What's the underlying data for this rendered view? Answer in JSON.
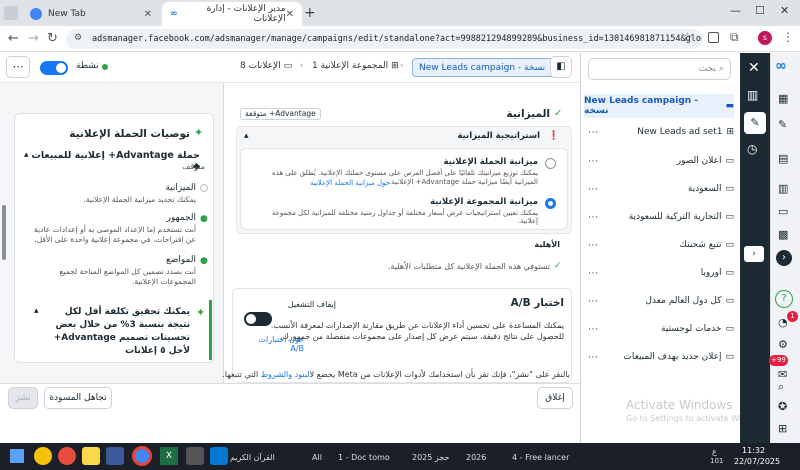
{
  "browser": {
    "tabs": [
      {
        "title": "New Tab"
      },
      {
        "title": "مدير الإعلانات - إدارة الإعلانات"
      }
    ],
    "url": "adsmanager.facebook.com/adsmanager/manage/campaigns/edit/standalone?act=998821294899289&business_id=130146981871154&global_scope_id=1301...",
    "profile_initial": "s"
  },
  "topbar": {
    "status_label": "نشطة",
    "campaign_name": "New Leads campaign - نسخة",
    "adsets_label": "1 المجموعة الإعلانية",
    "ads_label": "8 الإعلانات"
  },
  "nav": {
    "search_placeholder": "بحث",
    "items": [
      {
        "label": "New Leads campaign - نسخة"
      },
      {
        "label": "New Leads ad set1"
      },
      {
        "label": "اعلان الصور"
      },
      {
        "label": "السعودية"
      },
      {
        "label": "التجارية التركية للسعودية"
      },
      {
        "label": "تتبع شحنتك"
      },
      {
        "label": "اوروبا"
      },
      {
        "label": "كل دول العالم معدل"
      },
      {
        "label": "خدمات لوجستية"
      },
      {
        "label": "إعلان جديد بهدف المبيعات"
      }
    ]
  },
  "recommendations": {
    "title": "توصيات الحملة الإعلانية",
    "subtitle": "حملة Advantage+ إعلانية للمبيعات",
    "status": "متوقف",
    "items": [
      {
        "title": "الميزانية",
        "desc": "يمكنك تحديد ميزانية الحملة الإعلانية."
      },
      {
        "title": "الجمهور",
        "desc": "أنت تستخدم إما الإعداد الموصى به أو إعدادات عادية عن اقتراحات، في مجموعة إعلانية واحدة على الأقل."
      },
      {
        "title": "المواضع",
        "desc": "أنت بصدد تضمين كل المواضع المتاحة لجميع المجموعات الإعلانية."
      }
    ],
    "callout": "يمكنك تحقيق تكلفة أقل لكل نتيجة بنسبة 3% من خلال بعض تحسينات تصميم Advantage+ لأجل ٥ إعلانات"
  },
  "main": {
    "advantage_badge": "Advantage+ متوقفة",
    "budget_title": "الميزانية",
    "strategy_title": "استراتيجية الميزانية",
    "options": [
      {
        "title": "ميزانية الحملة الإعلانية",
        "desc": "يمكنك توزيع ميزانيتك تلقائيًا على أفضل الفرص على مستوى حملتك الإعلانية. يُطلق على هذه الميزانية أيضًا ميزانية حملة Advantage+ الإعلانية.",
        "link": "حول ميزانية الحملة الإعلانية",
        "selected": false
      },
      {
        "title": "ميزانية المجموعة الإعلانية",
        "desc": "يمكنك تعيين استراتيجيات عرض أسعار مختلفة أو جداول زمنية مختلفة للميزانية لكل مجموعة إعلانية.",
        "selected": true
      }
    ],
    "eligibility_title": "الأهلية",
    "eligibility_text": "تستوفي هذه الحملة الإعلانية كل متطلبات الأهلية.",
    "ab_title": "اختبار A/B",
    "ab_toggle_label": "إيقاف التشغيل",
    "ab_desc": "يمكنك المساعدة على تحسين أداء الإعلانات عن طريق مقارنة الإصدارات لمعرفة الأنسب. للحصول على نتائج دقيقة، سيتم عرض كل إصدار على مجموعات منفصلة من جمهورك.",
    "ab_link": "حول اختبارات A/B"
  },
  "footer": {
    "terms_prefix": "بالنقر على \"نشر\"، فإنك تقر بأن استخدامك لأدوات الإعلانات من Meta يخضع ل",
    "terms_link": "البنود والشروط",
    "terms_suffix": " التي تتبعها.",
    "close_label": "إغلاق",
    "discard_label": "تجاهل المسودة",
    "publish_label": "نشر"
  },
  "watermark": {
    "line1": "Activate Windows",
    "line2": "Go to Settings to activate Windows."
  },
  "taskbar": {
    "items": [
      "All",
      "القرآن الكريم",
      "1 - Doc tomo",
      "حجز 2025",
      "2026",
      "4 - Free lancer"
    ],
    "time": "11:32",
    "date": "22/07/2025",
    "lang": "ع",
    "badge": "101"
  },
  "rail": {
    "badge_red": "1",
    "badge_plus": "+99"
  },
  "colors": {
    "accent": "#1877f2",
    "rail": "#1c2b33",
    "success": "#31a24c"
  }
}
